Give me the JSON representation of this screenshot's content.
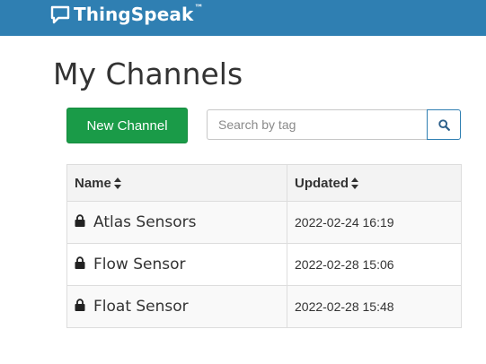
{
  "header": {
    "brand_name": "ThingSpeak",
    "brand_tm": "™",
    "brand_color": "#2f7fb2"
  },
  "page": {
    "title": "My Channels"
  },
  "toolbar": {
    "new_channel_label": "New Channel",
    "new_channel_color": "#1a9b48",
    "search_placeholder": "Search by tag",
    "search_value": "",
    "search_icon": "search-icon"
  },
  "table": {
    "columns": [
      {
        "label": "Name",
        "icon": "sort-icon"
      },
      {
        "label": "Updated",
        "icon": "sort-icon"
      }
    ],
    "rows": [
      {
        "name": "Atlas Sensors",
        "updated": "2022-02-24 16:19",
        "icon": "lock-icon"
      },
      {
        "name": "Flow Sensor",
        "updated": "2022-02-28 15:06",
        "icon": "lock-icon"
      },
      {
        "name": "Float Sensor",
        "updated": "2022-02-28 15:48",
        "icon": "lock-icon"
      }
    ]
  }
}
